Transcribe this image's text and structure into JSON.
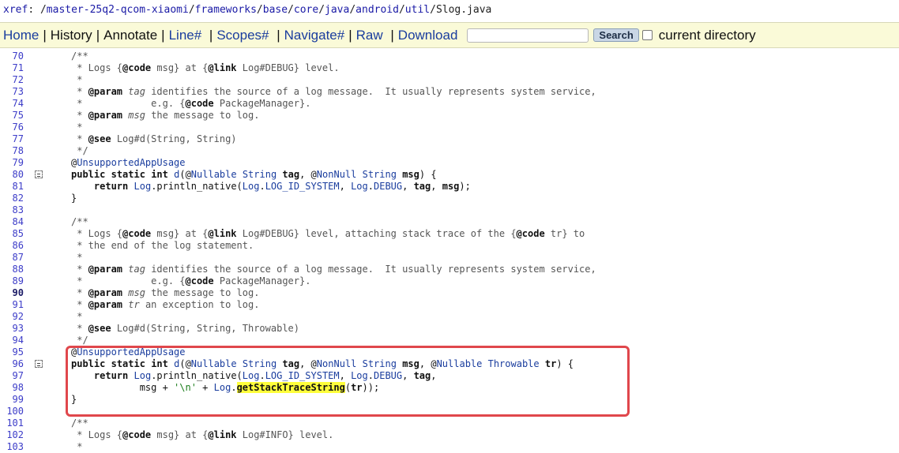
{
  "breadcrumb": {
    "prefix": "xref",
    "sep": ": /",
    "segments": [
      "master-25q2-qcom-xiaomi",
      "frameworks",
      "base",
      "core",
      "java",
      "android",
      "util",
      "Slog.java"
    ]
  },
  "nav": {
    "home": "Home",
    "history": "History",
    "annotate": "Annotate",
    "line": "Line#",
    "scopes": "Scopes#",
    "navigate": "Navigate#",
    "raw": "Raw",
    "download": "Download",
    "search_value": "",
    "search_button": "Search",
    "current_directory": "current directory",
    "current_directory_checked": false
  },
  "code": {
    "lines": [
      {
        "n": "70",
        "text": "/**"
      },
      {
        "n": "71",
        "text": " * Logs {@code msg} at {@link Log#DEBUG} level."
      },
      {
        "n": "72",
        "text": " *"
      },
      {
        "n": "73",
        "text": " * @param tag identifies the source of a log message.  It usually represents system service,"
      },
      {
        "n": "74",
        "text": " *            e.g. {@code PackageManager}."
      },
      {
        "n": "75",
        "text": " * @param msg the message to log."
      },
      {
        "n": "76",
        "text": " *"
      },
      {
        "n": "77",
        "text": " * @see Log#d(String, String)"
      },
      {
        "n": "78",
        "text": " */"
      },
      {
        "n": "79",
        "text": "@UnsupportedAppUsage"
      },
      {
        "n": "80",
        "text": "public static int d(@Nullable String tag, @NonNull String msg) {",
        "fold": true
      },
      {
        "n": "81",
        "text": "    return Log.println_native(Log.LOG_ID_SYSTEM, Log.DEBUG, tag, msg);"
      },
      {
        "n": "82",
        "text": "}"
      },
      {
        "n": "83",
        "text": ""
      },
      {
        "n": "84",
        "text": "/**"
      },
      {
        "n": "85",
        "text": " * Logs {@code msg} at {@link Log#DEBUG} level, attaching stack trace of the {@code tr} to"
      },
      {
        "n": "86",
        "text": " * the end of the log statement."
      },
      {
        "n": "87",
        "text": " *"
      },
      {
        "n": "88",
        "text": " * @param tag identifies the source of a log message.  It usually represents system service,"
      },
      {
        "n": "89",
        "text": " *            e.g. {@code PackageManager}."
      },
      {
        "n": "90",
        "text": " * @param msg the message to log.",
        "bold": true
      },
      {
        "n": "91",
        "text": " * @param tr an exception to log."
      },
      {
        "n": "92",
        "text": " *"
      },
      {
        "n": "93",
        "text": " * @see Log#d(String, String, Throwable)"
      },
      {
        "n": "94",
        "text": " */"
      },
      {
        "n": "95",
        "text": "@UnsupportedAppUsage"
      },
      {
        "n": "96",
        "text": "public static int d(@Nullable String tag, @NonNull String msg, @Nullable Throwable tr) {",
        "fold": true
      },
      {
        "n": "97",
        "text": "    return Log.println_native(Log.LOG_ID_SYSTEM, Log.DEBUG, tag,"
      },
      {
        "n": "98",
        "text": "            msg + '\\n' + Log.getStackTraceString(tr));"
      },
      {
        "n": "99",
        "text": "}"
      },
      {
        "n": "100",
        "text": ""
      },
      {
        "n": "101",
        "text": "/**"
      },
      {
        "n": "102",
        "text": " * Logs {@code msg} at {@link Log#INFO} level."
      },
      {
        "n": "103",
        "text": " *"
      }
    ]
  },
  "colors": {
    "nav_bg": "#fafad8",
    "link": "#1a3d9e",
    "line_number": "#3c3cc8",
    "highlight": "#ffff3b",
    "box_border": "#e0474c"
  }
}
